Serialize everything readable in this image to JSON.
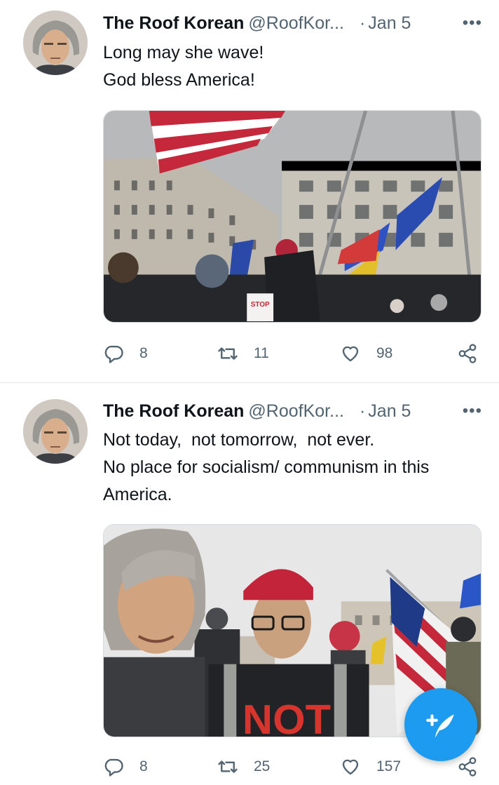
{
  "tweets": [
    {
      "author_name": "The Roof Korean",
      "handle": "@RoofKor...",
      "dot": "·",
      "date": "Jan 5",
      "more_icon": "more-horizontal-icon",
      "text_lines": [
        "Long may she wave!",
        "God bless America!"
      ],
      "photo": "rally-flags-buildings",
      "photo_sign_text": "STOP THE STEAL",
      "actions": {
        "replies": "8",
        "retweets": "11",
        "likes": "98"
      }
    },
    {
      "author_name": "The Roof Korean",
      "handle": "@RoofKor...",
      "dot": "·",
      "date": "Jan 5",
      "more_icon": "more-horizontal-icon",
      "text_lines": [
        "Not today,  not tomorrow,  not ever.",
        "No place for socialism/ communism in this",
        "America."
      ],
      "photo": "selfie-at-rally",
      "photo_shirt_text": "NOT",
      "actions": {
        "replies": "8",
        "retweets": "25",
        "likes": "157"
      }
    }
  ],
  "icons": [
    "reply-icon",
    "retweet-icon",
    "like-icon",
    "share-icon",
    "compose-tweet-icon"
  ],
  "colors": {
    "accent": "#1d9bf0",
    "secondary_text": "#536471",
    "primary_text": "#0f1419"
  }
}
